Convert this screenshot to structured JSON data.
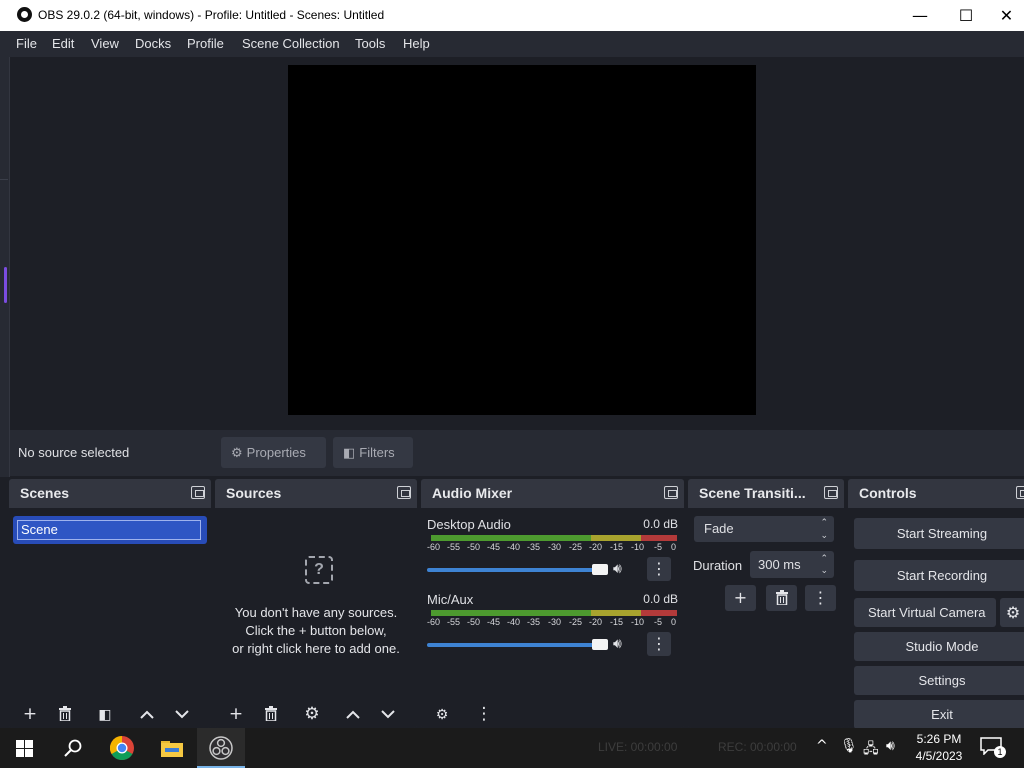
{
  "window": {
    "title": "OBS 29.0.2 (64-bit, windows) - Profile: Untitled - Scenes: Untitled",
    "controls": {
      "minimize": "—",
      "maximize": "☐",
      "close": "✕"
    }
  },
  "menu": [
    "File",
    "Edit",
    "View",
    "Docks",
    "Profile",
    "Scene Collection",
    "Tools",
    "Help"
  ],
  "context_bar": {
    "status": "No source selected",
    "properties": "Properties",
    "filters": "Filters"
  },
  "docks": {
    "scenes": {
      "title": "Scenes",
      "items": [
        "Scene"
      ]
    },
    "sources": {
      "title": "Sources",
      "empty_icon": "?",
      "empty_lines": [
        "You don't have any sources.",
        "Click the + button below,",
        "or right click here to add one."
      ]
    },
    "audio_mixer": {
      "title": "Audio Mixer",
      "ticks": [
        "-60",
        "-55",
        "-50",
        "-45",
        "-40",
        "-35",
        "-30",
        "-25",
        "-20",
        "-15",
        "-10",
        "-5",
        "0"
      ],
      "channels": [
        {
          "name": "Desktop Audio",
          "db": "0.0 dB",
          "volume": 1.0
        },
        {
          "name": "Mic/Aux",
          "db": "0.0 dB",
          "volume": 1.0
        }
      ]
    },
    "transitions": {
      "title": "Scene Transiti...",
      "selected": "Fade",
      "duration_label": "Duration",
      "duration_value": "300 ms"
    },
    "controls": {
      "title": "Controls",
      "buttons": [
        "Start Streaming",
        "Start Recording",
        "Start Virtual Camera",
        "Studio Mode",
        "Settings",
        "Exit"
      ]
    }
  },
  "taskbar": {
    "live": "LIVE: 00:00:00",
    "rec": "REC: 00:00:00",
    "time": "5:26 PM",
    "date": "4/5/2023",
    "notification_count": "1"
  },
  "colors": {
    "accent": "#284cb8",
    "meter_green": "#4d9a2f",
    "meter_yellow": "#a8a32e",
    "meter_red": "#b33a3a",
    "slider": "#3e83d3"
  }
}
